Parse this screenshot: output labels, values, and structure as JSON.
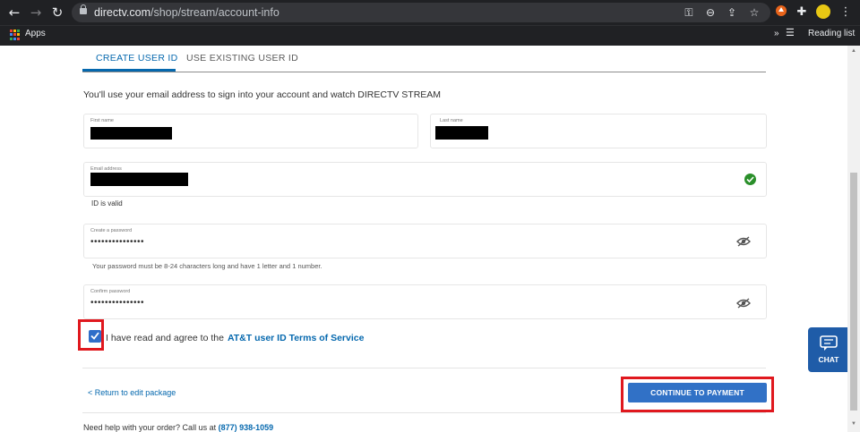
{
  "browser": {
    "url_domain": "directv.com",
    "url_path": "/shop/stream/account-info",
    "bookmarks": {
      "apps_label": "Apps",
      "overflow": "»",
      "reading_list_label": "Reading list"
    }
  },
  "tabs": {
    "create_label": "CREATE USER ID",
    "existing_label": "USE EXISTING USER ID"
  },
  "intro_text": "You'll use your email address to sign into your account and watch DIRECTV STREAM",
  "form": {
    "first_name_label": "First name",
    "last_name_label": "Last name",
    "email_label": "Email address",
    "id_valid_text": "ID is valid",
    "password_label": "Create a password",
    "password_value": "•••••••••••••••",
    "password_hint": "Your password must be 8-24 characters long and have 1 letter and 1 number.",
    "confirm_label": "Confirm password",
    "confirm_value": "•••••••••••••••",
    "agree_text": "I have read and agree to the",
    "terms_link": "AT&T user ID Terms of Service",
    "agree_checked": true
  },
  "actions": {
    "return_label": "< Return to edit package",
    "continue_label": "CONTINUE TO PAYMENT"
  },
  "footer": {
    "help_text": "Need help with your order? Call us at",
    "phone": "(877) 938-1059"
  },
  "chat": {
    "label": "CHAT"
  },
  "colors": {
    "brand_blue": "#0568ae",
    "button_blue": "#3171c6",
    "highlight_red": "#e0181e",
    "success_green": "#2a8f2a",
    "chat_bg": "#1f5ca8"
  }
}
